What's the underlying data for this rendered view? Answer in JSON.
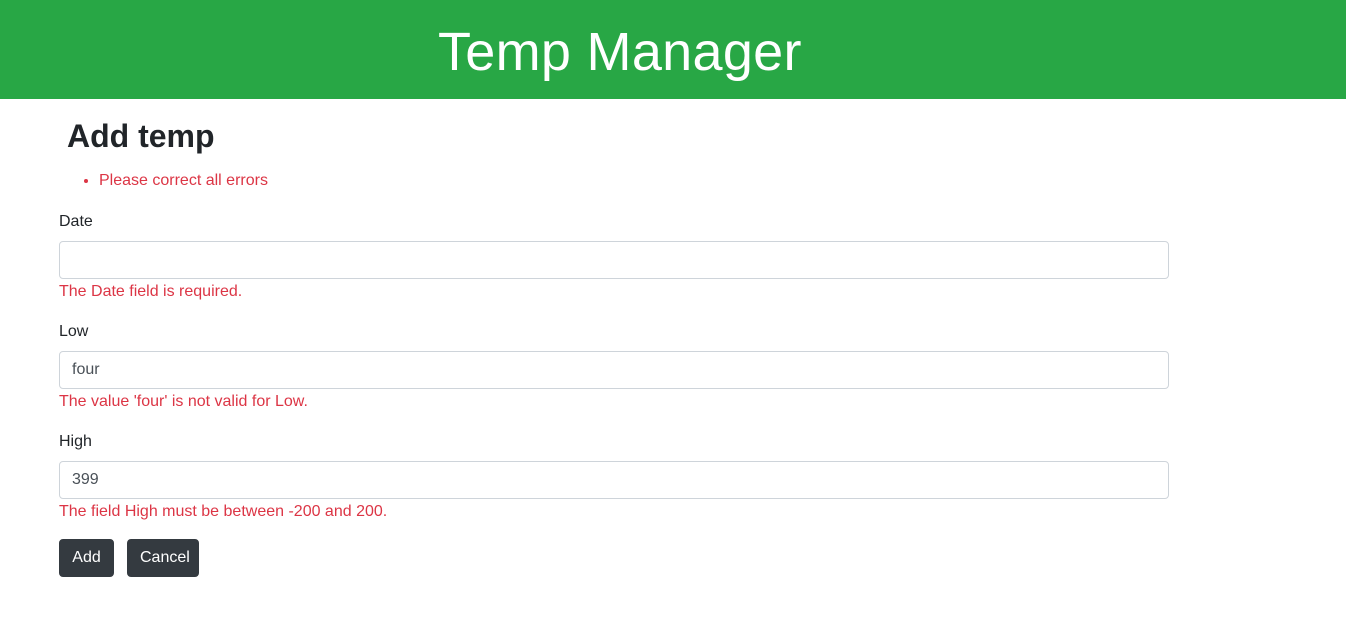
{
  "header": {
    "title": "Temp Manager",
    "background_color": "#28a745"
  },
  "page": {
    "title": "Add temp"
  },
  "validation_summary": {
    "items": [
      "Please correct all errors"
    ],
    "color": "#dc3545"
  },
  "form": {
    "date": {
      "label": "Date",
      "value": "",
      "error": "The Date field is required."
    },
    "low": {
      "label": "Low",
      "value": "four",
      "error": "The value 'four' is not valid for Low."
    },
    "high": {
      "label": "High",
      "value": "399",
      "error": "The field High must be between -200 and 200."
    }
  },
  "actions": {
    "add_label": "Add",
    "cancel_label": "Cancel",
    "button_color": "#343a40"
  }
}
